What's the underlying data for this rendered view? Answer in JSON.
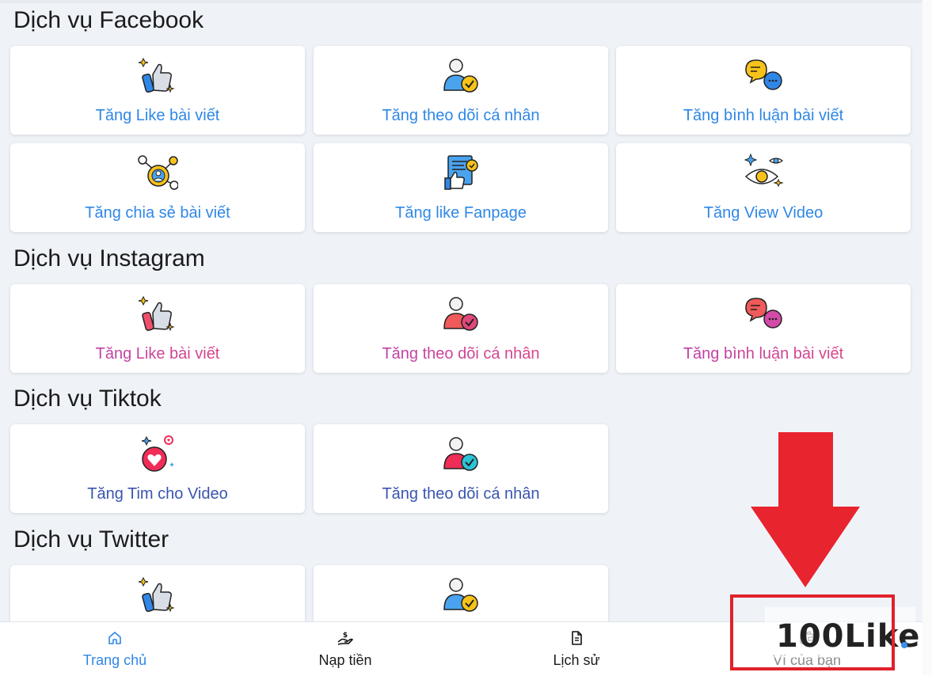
{
  "sections": {
    "facebook": {
      "title": "Dịch vụ Facebook",
      "cards": [
        {
          "label": "Tăng Like bài viết",
          "icon": "thumbs-up-icon"
        },
        {
          "label": "Tăng theo dõi cá nhân",
          "icon": "user-follow-icon"
        },
        {
          "label": "Tăng bình luận bài viết",
          "icon": "comment-bubbles-icon"
        },
        {
          "label": "Tăng chia sẻ bài viết",
          "icon": "share-network-icon"
        },
        {
          "label": "Tăng like Fanpage",
          "icon": "fanpage-like-icon"
        },
        {
          "label": "Tăng View Video",
          "icon": "eye-view-icon"
        }
      ]
    },
    "instagram": {
      "title": "Dịch vụ Instagram",
      "cards": [
        {
          "label": "Tăng Like bài viết",
          "icon": "thumbs-up-icon"
        },
        {
          "label": "Tăng theo dõi cá nhân",
          "icon": "user-follow-icon"
        },
        {
          "label": "Tăng bình luận bài viết",
          "icon": "comment-bubbles-icon"
        }
      ]
    },
    "tiktok": {
      "title": "Dịch vụ Tiktok",
      "cards": [
        {
          "label": "Tăng Tim cho Video",
          "icon": "heart-icon"
        },
        {
          "label": "Tăng theo dõi cá nhân",
          "icon": "user-follow-icon"
        }
      ]
    },
    "twitter": {
      "title": "Dịch vụ Twitter",
      "cards": [
        {
          "icon": "thumbs-up-icon"
        },
        {
          "icon": "user-follow-icon"
        }
      ]
    }
  },
  "bottom_nav": [
    {
      "label": "Trang chủ",
      "icon": "home-icon",
      "active": true
    },
    {
      "label": "Nạp tiền",
      "icon": "deposit-hand-icon"
    },
    {
      "label": "Lịch sử",
      "icon": "document-icon"
    },
    {
      "label": "Ví của bạn",
      "icon": "wallet-icon"
    }
  ],
  "watermark": {
    "text": "100Like"
  },
  "colors": {
    "facebook_blue": "#2f87e6",
    "instagram_purple": "#b03fb4",
    "instagram_pink": "#e9457a",
    "tiktok_blue": "#3a55b0",
    "highlight_red": "#e0222b",
    "page_bg": "#eff3f8"
  }
}
